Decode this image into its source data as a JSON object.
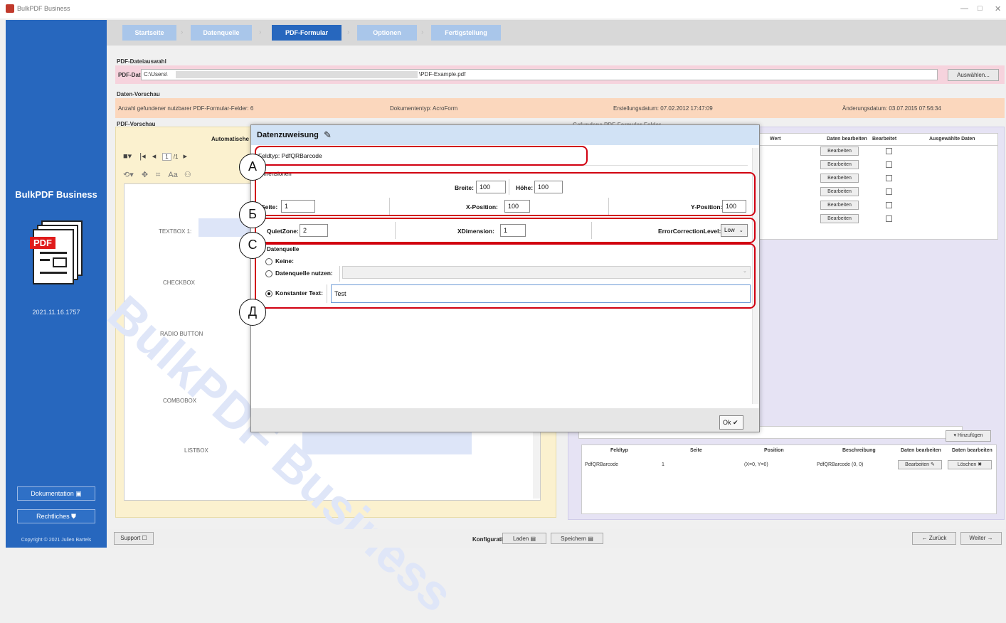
{
  "window": {
    "title": "BulkPDF Business",
    "minimize": "—",
    "maximize": "□",
    "close": "✕"
  },
  "sidebar": {
    "brand": "BulkPDF Business",
    "pdf_label": "PDF",
    "version": "2021.11.16.1757",
    "docs_button": "Dokumentation",
    "legal_button": "Rechtliches",
    "copyright": "Copyright © 2021 Julien Bartels"
  },
  "steps": [
    "Startseite",
    "Datenquelle",
    "PDF-Formular",
    "Optionen",
    "Fertigstellung"
  ],
  "file_section": {
    "title": "PDF-Dateiauswahl",
    "label": "PDF-Datei:",
    "path_start": "C:\\Users\\",
    "path_end": "\\PDF-Example.pdf",
    "browse_button": "Auswählen..."
  },
  "data_preview": {
    "title": "Daten-Vorschau",
    "fields_count": "Anzahl gefundener nutzbarer PDF-Formular-Felder: 6",
    "doc_type": "Dokumententyp: AcroForm",
    "created": "Erstellungsdatum: 07.02.2012 17:47:09",
    "modified": "Änderungsdatum: 03.07.2015 07:56:34"
  },
  "pdf_preview": {
    "title": "PDF-Vorschau",
    "subtitle": "Automatische",
    "page": "1",
    "page_total": "/1",
    "fields": [
      "TEXTBOX 1:",
      "CHECKBOX",
      "RADIO BUTTON",
      "COMBOBOX",
      "LISTBOX"
    ],
    "watermark": "BulkPDF Business"
  },
  "fields_table": {
    "title": "Gefundene PDF-Formular-Felder",
    "headers": [
      "Wert",
      "Daten bearbeiten",
      "Bearbeitet",
      "Ausgewählte Daten"
    ],
    "edit_label": "Bearbeiten"
  },
  "barcode_table": {
    "add_button": "Hinzufügen",
    "headers": [
      "Feldtyp",
      "Seite",
      "Position",
      "Beschreibung",
      "Daten bearbeiten",
      "Daten bearbeiten"
    ],
    "row": {
      "type": "PdfQRBarcode",
      "page": "1",
      "position": "(X=0, Y=0)",
      "description": "PdfQRBarcode (0, 0)",
      "edit": "Bearbeiten",
      "delete": "Löschen"
    }
  },
  "bottom": {
    "support": "Support",
    "config_label": "Konfiguration:",
    "load": "Laden",
    "save": "Speichern",
    "back": "← Zurück",
    "next": "Weiter →"
  },
  "dialog": {
    "title": "Datenzuweisung",
    "field_type": "Feldtyp: PdfQRBarcode",
    "dimensions_label": "Dimensionen",
    "width_label": "Breite:",
    "width_value": "100",
    "height_label": "Höhe:",
    "height_value": "100",
    "page_label": "Seite:",
    "page_value": "1",
    "xpos_label": "X-Position:",
    "xpos_value": "100",
    "ypos_label": "Y-Position:",
    "ypos_value": "100",
    "quietzone_label": "QuietZone:",
    "quietzone_value": "2",
    "xdim_label": "XDimension:",
    "xdim_value": "1",
    "ecl_label": "ErrorCorrectionLevel:",
    "ecl_value": "Low",
    "source_label": "Datenquelle",
    "none_label": "Keine:",
    "use_source_label": "Datenquelle nutzen:",
    "constant_label": "Konstanter Text:",
    "constant_value": "Test",
    "ok_button": "Ok"
  },
  "callouts": [
    "А",
    "Б",
    "С",
    "Д"
  ]
}
